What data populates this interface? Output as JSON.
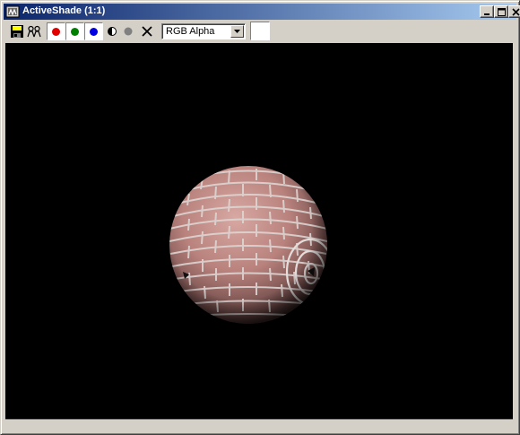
{
  "window": {
    "title": "ActiveShade (1:1)"
  },
  "toolbar": {
    "save_icon": "save-icon",
    "clone_icon": "clone-icon",
    "channels": [
      {
        "name": "red-channel",
        "color": "#e00000"
      },
      {
        "name": "green-channel",
        "color": "#008000"
      },
      {
        "name": "blue-channel",
        "color": "#0000e0"
      }
    ],
    "mono_icon": "monochrome-icon",
    "alpha_dot_color": "#808080",
    "clear_icon": "clear-icon",
    "channel_select_value": "RGB Alpha",
    "swatch_color": "#ffffff"
  },
  "viewport": {
    "background": "#000000",
    "sphere_base_color": "#c08a86",
    "mortar_color": "#dcd6d4"
  }
}
